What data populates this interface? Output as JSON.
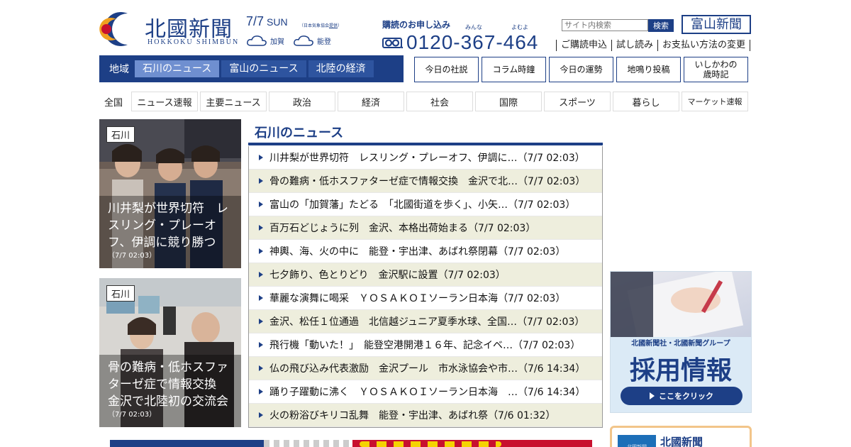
{
  "header": {
    "logo_name": "北國新聞",
    "logo_roman": "HOKKOKU SHIMBUN",
    "date": "7/7",
    "day_of_week": "SUN",
    "jma_note_prefix": "（日本気象協会",
    "jma_note_link": "提供",
    "jma_note_suffix": "）",
    "weather": [
      {
        "icon": "cloud-icon",
        "region": "加賀"
      },
      {
        "icon": "cloud-icon",
        "region": "能登"
      }
    ],
    "subscribe_title": "購読のお申し込み",
    "phone_ruby_1": "みんな",
    "phone_ruby_2": "よむよ",
    "phone_number": "0120-367-464",
    "search_placeholder": "サイト内検索",
    "search_button": "検索",
    "toyama_button": "富山新聞",
    "links": [
      "ご購読申込",
      "試し読み",
      "お支払い方法の変更"
    ]
  },
  "region_nav": {
    "label": "地域",
    "tabs": [
      {
        "label": "石川のニュース",
        "active": true
      },
      {
        "label": "富山のニュース",
        "active": false
      },
      {
        "label": "北陸の経済",
        "active": false
      }
    ]
  },
  "box_buttons": [
    "今日の社説",
    "コラム時鐘",
    "今日の運勢",
    "地鳴り投稿",
    "いしかわの\n歳時記"
  ],
  "category_nav": [
    "全国",
    "ニュース速報",
    "主要ニュース",
    "政治",
    "経済",
    "社会",
    "国際",
    "スポーツ",
    "暮らし",
    "マーケット速報"
  ],
  "photo_cards": [
    {
      "tag": "石川",
      "title": "川井梨が世界切符　レスリング・プレーオフ、伊調に競り勝つ",
      "time": "（7/7 02:03）"
    },
    {
      "tag": "石川",
      "title": "骨の難病・低ホスファターゼ症で情報交換　金沢で北陸初の交流会",
      "time": "（7/7 02:03）"
    }
  ],
  "news": {
    "title": "石川のニュース",
    "items": [
      "川井梨が世界切符　レスリング・プレーオフ、伊調に…（7/7 02:03）",
      "骨の難病・低ホスファターゼ症で情報交換　金沢で北…（7/7 02:03）",
      "富山の「加賀藩」たどる　「北國街道を歩く」、小矢…（7/7 02:03）",
      "百万石どじょうに列　金沢、本格出荷始まる（7/7 02:03）",
      "神輿、海、火の中に　能登・宇出津、あばれ祭閉幕（7/7 02:03）",
      "七夕飾り、色とりどり　金沢駅に設置（7/7 02:03）",
      "華麗な演舞に喝采　ＹＯＳＡＫＯＩソーラン日本海（7/7 02:03）",
      "金沢、松任１位通過　北信越ジュニア夏季水球、全国…（7/7 02:03）",
      "飛行機「動いた！」　能登空港開港１６年、記念イベ…（7/7 02:03）",
      "仏の飛び込み代表激励　金沢プール　市水泳協会や市…（7/6 14:34）",
      "踊り子躍動に沸く　ＹＯＳＡＫＯＩソーラン日本海　…（7/6 14:34）",
      "火の粉浴びキリコ乱舞　能登・宇出津、あばれ祭（7/6 01:32）"
    ]
  },
  "ad": {
    "subtitle": "北國新聞社・北國新聞グループ",
    "headline": "採用情報",
    "cta": "ここをクリック"
  },
  "promo": {
    "image_label": "北國新聞",
    "text": "北國新聞"
  },
  "colors": {
    "brand_navy": "#1d3f86",
    "active_tab": "#6f8fd0",
    "stripe": "#eeeedd",
    "promo_border": "#f2c58a"
  }
}
